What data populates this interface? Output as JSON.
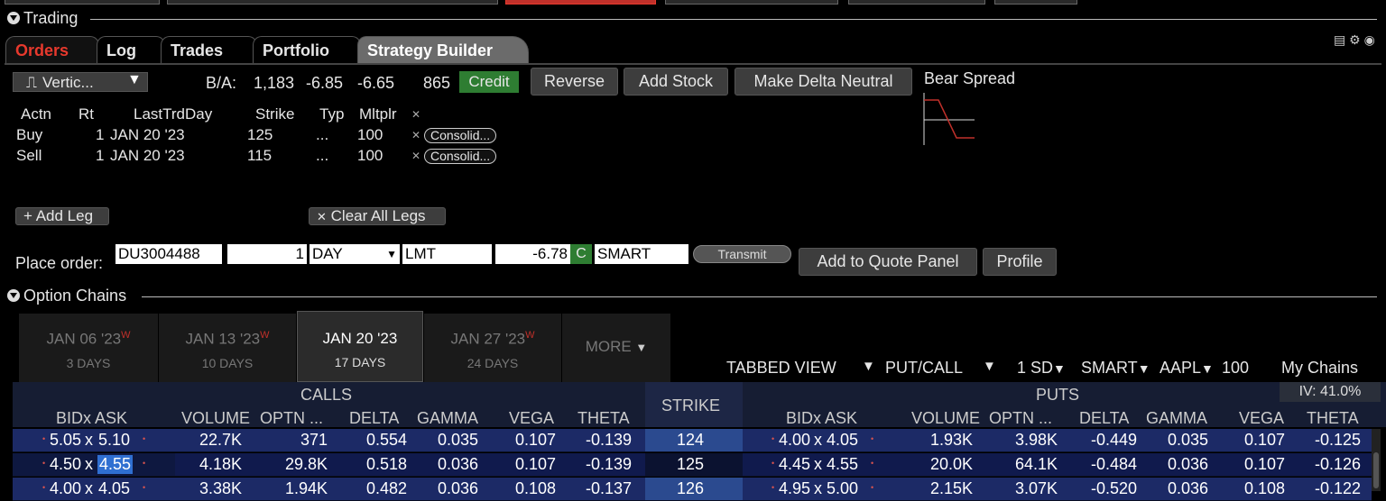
{
  "trading": {
    "title": "Trading",
    "tabs": [
      "Orders",
      "Log",
      "Trades",
      "Portfolio",
      "Strategy Builder"
    ]
  },
  "strategy": {
    "type_label": "Vertic...",
    "ba_label": "B/A:",
    "bid_size": "1,183",
    "bid": "-6.85",
    "ask": "-6.65",
    "ask_size": "865",
    "credit_label": "Credit",
    "buttons": [
      "Reverse",
      "Add Stock",
      "Make Delta Neutral"
    ],
    "spread_name": "Bear Spread",
    "leg_headers": [
      "Actn",
      "Rt",
      "LastTrdDay",
      "Strike",
      "Typ",
      "Mltplr"
    ],
    "legs": [
      {
        "action": "Buy",
        "ratio": "1",
        "last_day": "JAN 20 '23",
        "strike": "125",
        "type": "...",
        "mult": "100",
        "route": "Consolid..."
      },
      {
        "action": "Sell",
        "ratio": "1",
        "last_day": "JAN 20 '23",
        "strike": "115",
        "type": "...",
        "mult": "100",
        "route": "Consolid..."
      }
    ],
    "add_leg": "+ Add Leg",
    "clear_legs": "Clear All Legs",
    "place_order_label": "Place order:",
    "account": "DU3004488",
    "quantity": "1",
    "tif": "DAY",
    "order_type": "LMT",
    "limit_price": "-6.78",
    "c_flag": "C",
    "destination": "SMART",
    "transmit": "Transmit",
    "add_quote_panel": "Add to Quote Panel",
    "profile": "Profile"
  },
  "option_chains": {
    "title": "Option Chains",
    "expirations": [
      {
        "date": "JAN 06 '23",
        "sup": "W",
        "days": "3 DAYS"
      },
      {
        "date": "JAN 13 '23",
        "sup": "W",
        "days": "10 DAYS"
      },
      {
        "date": "JAN 20 '23",
        "sup": "",
        "days": "17 DAYS"
      },
      {
        "date": "JAN 27 '23",
        "sup": "W",
        "days": "24 DAYS"
      }
    ],
    "more": "MORE",
    "toolbar": {
      "view": "TABBED VIEW",
      "putcall": "PUT/CALL",
      "sd": "1 SD",
      "exchange": "SMART",
      "symbol": "AAPL",
      "mult": "100",
      "my_chains": "My Chains"
    },
    "iv": "IV: 41.0%",
    "calls_label": "CALLS",
    "puts_label": "PUTS",
    "strike_label": "STRIKE",
    "columns": [
      "BIDx ASK",
      "VOLUME",
      "OPTN ...",
      "DELTA",
      "GAMMA",
      "VEGA",
      "THETA"
    ],
    "rows": [
      {
        "call_bid": "5.05",
        "call_ask": "5.10",
        "call_vol": "22.7K",
        "call_oi": "371",
        "call_delta": "0.554",
        "call_gamma": "0.035",
        "call_vega": "0.107",
        "call_theta": "-0.139",
        "strike": "124",
        "put_bid": "4.00",
        "put_ask": "4.05",
        "put_vol": "1.93K",
        "put_oi": "3.98K",
        "put_delta": "-0.449",
        "put_gamma": "0.035",
        "put_vega": "0.107",
        "put_theta": "-0.125"
      },
      {
        "call_bid": "4.50",
        "call_ask": "4.55",
        "call_vol": "4.18K",
        "call_oi": "29.8K",
        "call_delta": "0.518",
        "call_gamma": "0.036",
        "call_vega": "0.107",
        "call_theta": "-0.139",
        "strike": "125",
        "put_bid": "4.45",
        "put_ask": "4.55",
        "put_vol": "20.0K",
        "put_oi": "64.1K",
        "put_delta": "-0.484",
        "put_gamma": "0.036",
        "put_vega": "0.107",
        "put_theta": "-0.126"
      },
      {
        "call_bid": "4.00",
        "call_ask": "4.05",
        "call_vol": "3.38K",
        "call_oi": "1.94K",
        "call_delta": "0.482",
        "call_gamma": "0.036",
        "call_vega": "0.108",
        "call_theta": "-0.137",
        "strike": "126",
        "put_bid": "4.95",
        "put_ask": "5.00",
        "put_vol": "2.15K",
        "put_oi": "3.07K",
        "put_delta": "-0.520",
        "put_gamma": "0.036",
        "put_vega": "0.108",
        "put_theta": "-0.122"
      }
    ]
  },
  "colors": {
    "accent_red": "#e8392d",
    "credit_green": "#2e7d32",
    "row_blue": "#1c2a66",
    "selected_blue": "#2f6fd1"
  }
}
